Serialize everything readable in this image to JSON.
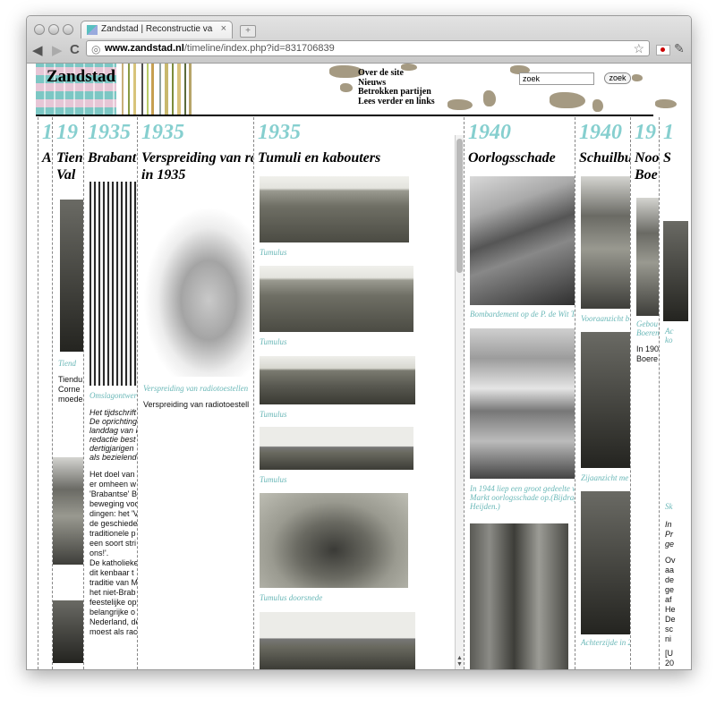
{
  "browser": {
    "tab_title": "Zandstad | Reconstructie va",
    "tab_close": "×",
    "url_domain": "www.zandstad.nl",
    "url_path": "/timeline/index.php?id=831706839"
  },
  "site": {
    "logo": "Zandstad",
    "menu": [
      "Over de site",
      "Nieuws",
      "Betrokken partijen",
      "Lees verder en links"
    ],
    "search_value": "zoek",
    "search_button": "zoek"
  },
  "columns": [
    {
      "year": "1",
      "title": "A"
    },
    {
      "year": "19",
      "title": "Tien",
      "title2": "Val",
      "caption": "Tiend",
      "body": [
        "Tiendu",
        "Corne",
        "moede"
      ]
    },
    {
      "year": "1935",
      "title": "Brabant",
      "caption": "Omslagontwerp",
      "italic": [
        "Het tijdschrift",
        "De oprichting",
        "landdag van I",
        "redactie best",
        "dertigjarigen",
        "als bezielend"
      ],
      "body": [
        "Het doel van",
        "er omheen w",
        "'Brabantse' B",
        "beweging voo",
        "dingen: het 'V",
        "de geschiede",
        "traditionele p",
        "een soort stri",
        "ons!'.",
        "De katholieke",
        "dit kenbaar t",
        "traditie van M",
        "het niet-Brab",
        "feestelijke op",
        "belangrijke o",
        "Nederland, de",
        "moest als rac"
      ]
    },
    {
      "year": "1935",
      "title": "Verspreiding van ra",
      "title2": "in 1935",
      "caption": "Verspreiding van radiotoestellen",
      "body": [
        "Verspreiding van radiotoestell"
      ]
    },
    {
      "year": "1935",
      "title": "Tumuli en kabouters",
      "captions": [
        "Tumulus",
        "Tumulus",
        "Tumulus",
        "Tumulus",
        "Tumulus doorsnede"
      ]
    },
    {
      "year": "1940",
      "title": "Oorlogsschade",
      "captions": [
        "Bombardement op de P. de Wit T",
        "In 1944 liep een groot gedeelte v",
        "Markt oorlogsschade op.(Bijdrage",
        "Heijden.)"
      ]
    },
    {
      "year": "1940",
      "title": "Schuilbu",
      "captions": [
        "Vooraanzicht b",
        "Zijaanzicht me",
        "Achterzijde in 2"
      ]
    },
    {
      "year": "19",
      "title": "Noo",
      "title2": "Boe",
      "captions": [
        "Gebou",
        "Boeren"
      ],
      "body": [
        "In 190",
        "Boere"
      ]
    },
    {
      "year": "1",
      "title": "S",
      "captions": [
        "Ac",
        "ko",
        "Sk"
      ],
      "italic": [
        "In",
        "Pr",
        "ge"
      ],
      "body": [
        "Ov",
        "aa",
        "de",
        "ge",
        "af",
        "He",
        "De",
        "sc",
        "ni",
        "[U",
        "20"
      ]
    }
  ]
}
